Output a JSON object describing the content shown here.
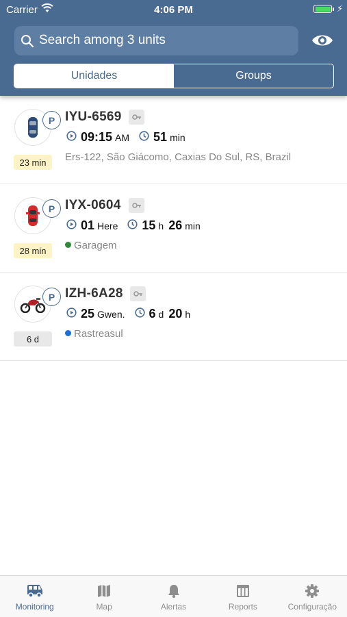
{
  "status_bar": {
    "carrier": "Carrier",
    "time": "4:06 PM"
  },
  "search": {
    "placeholder": "Search among 3 units"
  },
  "segments": {
    "unidades": "Unidades",
    "groups": "Groups"
  },
  "units": [
    {
      "name": "IYU-6569",
      "p_label": "P",
      "age": "23 min",
      "time_value": "09:15",
      "time_unit": "AM",
      "dur_value": "51",
      "dur_unit": "min",
      "dur_value2": "",
      "dur_unit2": "",
      "location": "Ers-122, São Giácomo, Caxias Do Sul, RS, Brazil",
      "location_dot": ""
    },
    {
      "name": "IYX-0604",
      "p_label": "P",
      "age": "28 min",
      "time_value": "01",
      "time_unit": "Here",
      "dur_value": "15",
      "dur_unit": "h",
      "dur_value2": "26",
      "dur_unit2": "min",
      "location": "Garagem",
      "location_dot": "#2e8b3a"
    },
    {
      "name": "IZH-6A28",
      "p_label": "P",
      "age": "6 d",
      "time_value": "25",
      "time_unit": "Gwen.",
      "dur_value": "6",
      "dur_unit": "d",
      "dur_value2": "20",
      "dur_unit2": "h",
      "location": "Rastreasul",
      "location_dot": "#1a6fd6"
    }
  ],
  "tabs": {
    "monitoring": "Monitoring",
    "map": "Map",
    "alertas": "Alertas",
    "reports": "Reports",
    "configuracao": "Configuração"
  },
  "colors": {
    "header": "#4a6b91",
    "accent": "#4a6b91",
    "age_recent": "#fdf3c4",
    "age_old": "#e8e8e8"
  }
}
